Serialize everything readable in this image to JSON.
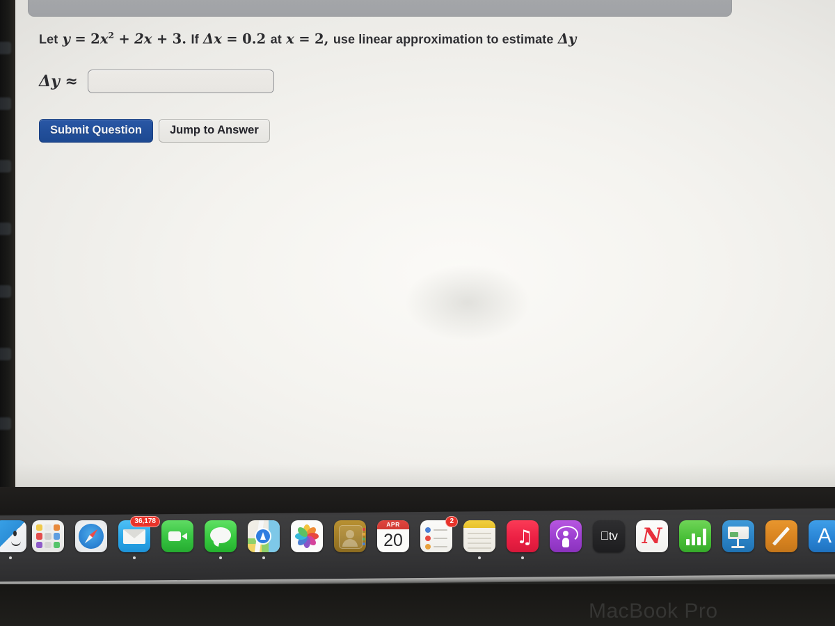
{
  "question": {
    "prefix": "Let",
    "y_var": "y",
    "eq": "=",
    "term1_coef": "2",
    "term1_var": "x",
    "term1_exp": "2",
    "plus1": "+",
    "term2": "2x",
    "plus2": "+",
    "term3": "3.",
    "if_word": "If",
    "delta_x": "Δx",
    "eq2": "=",
    "dx_value": "0.2",
    "at_word": "at",
    "x_var": "x",
    "eq3": "=",
    "x_value": "2,",
    "tail": "use linear approximation to estimate",
    "delta_y": "Δy",
    "full_text": "Let y = 2x² + 2x + 3. If Δx = 0.2 at x = 2, use linear approximation to estimate Δy"
  },
  "answer": {
    "label_delta_y": "Δy",
    "label_approx": "≈",
    "value": "",
    "placeholder": ""
  },
  "buttons": {
    "submit_label": "Submit Question",
    "jump_label": "Jump to Answer",
    "submit_color": "#23509c"
  },
  "device": {
    "wordmark": "MacBook Pro"
  },
  "dock": {
    "items": [
      {
        "name": "finder",
        "label": "Finder",
        "running": true,
        "badge": ""
      },
      {
        "name": "launchpad",
        "label": "Launchpad",
        "running": false,
        "badge": ""
      },
      {
        "name": "safari",
        "label": "Safari",
        "running": false,
        "badge": ""
      },
      {
        "name": "mail",
        "label": "Mail",
        "running": true,
        "badge": "36,178"
      },
      {
        "name": "facetime",
        "label": "FaceTime",
        "running": false,
        "badge": ""
      },
      {
        "name": "messages",
        "label": "Messages",
        "running": true,
        "badge": ""
      },
      {
        "name": "maps",
        "label": "Maps",
        "running": true,
        "badge": ""
      },
      {
        "name": "photos",
        "label": "Photos",
        "running": false,
        "badge": ""
      },
      {
        "name": "contacts",
        "label": "Contacts",
        "running": false,
        "badge": ""
      },
      {
        "name": "calendar",
        "label": "Calendar",
        "running": false,
        "badge": "",
        "month": "APR",
        "day": "20"
      },
      {
        "name": "reminders",
        "label": "Reminders",
        "running": false,
        "badge": "2"
      },
      {
        "name": "notes",
        "label": "Notes",
        "running": true,
        "badge": ""
      },
      {
        "name": "music",
        "label": "Music",
        "running": true,
        "badge": ""
      },
      {
        "name": "podcasts",
        "label": "Podcasts",
        "running": false,
        "badge": ""
      },
      {
        "name": "appletv",
        "label": "Apple TV",
        "running": false,
        "badge": "",
        "text": "tv"
      },
      {
        "name": "news",
        "label": "News",
        "running": false,
        "badge": ""
      },
      {
        "name": "numbers",
        "label": "Numbers",
        "running": false,
        "badge": ""
      },
      {
        "name": "keynote",
        "label": "Keynote",
        "running": false,
        "badge": ""
      },
      {
        "name": "pages",
        "label": "Pages",
        "running": false,
        "badge": ""
      },
      {
        "name": "appstore",
        "label": "App Store",
        "running": false,
        "badge": ""
      }
    ]
  }
}
